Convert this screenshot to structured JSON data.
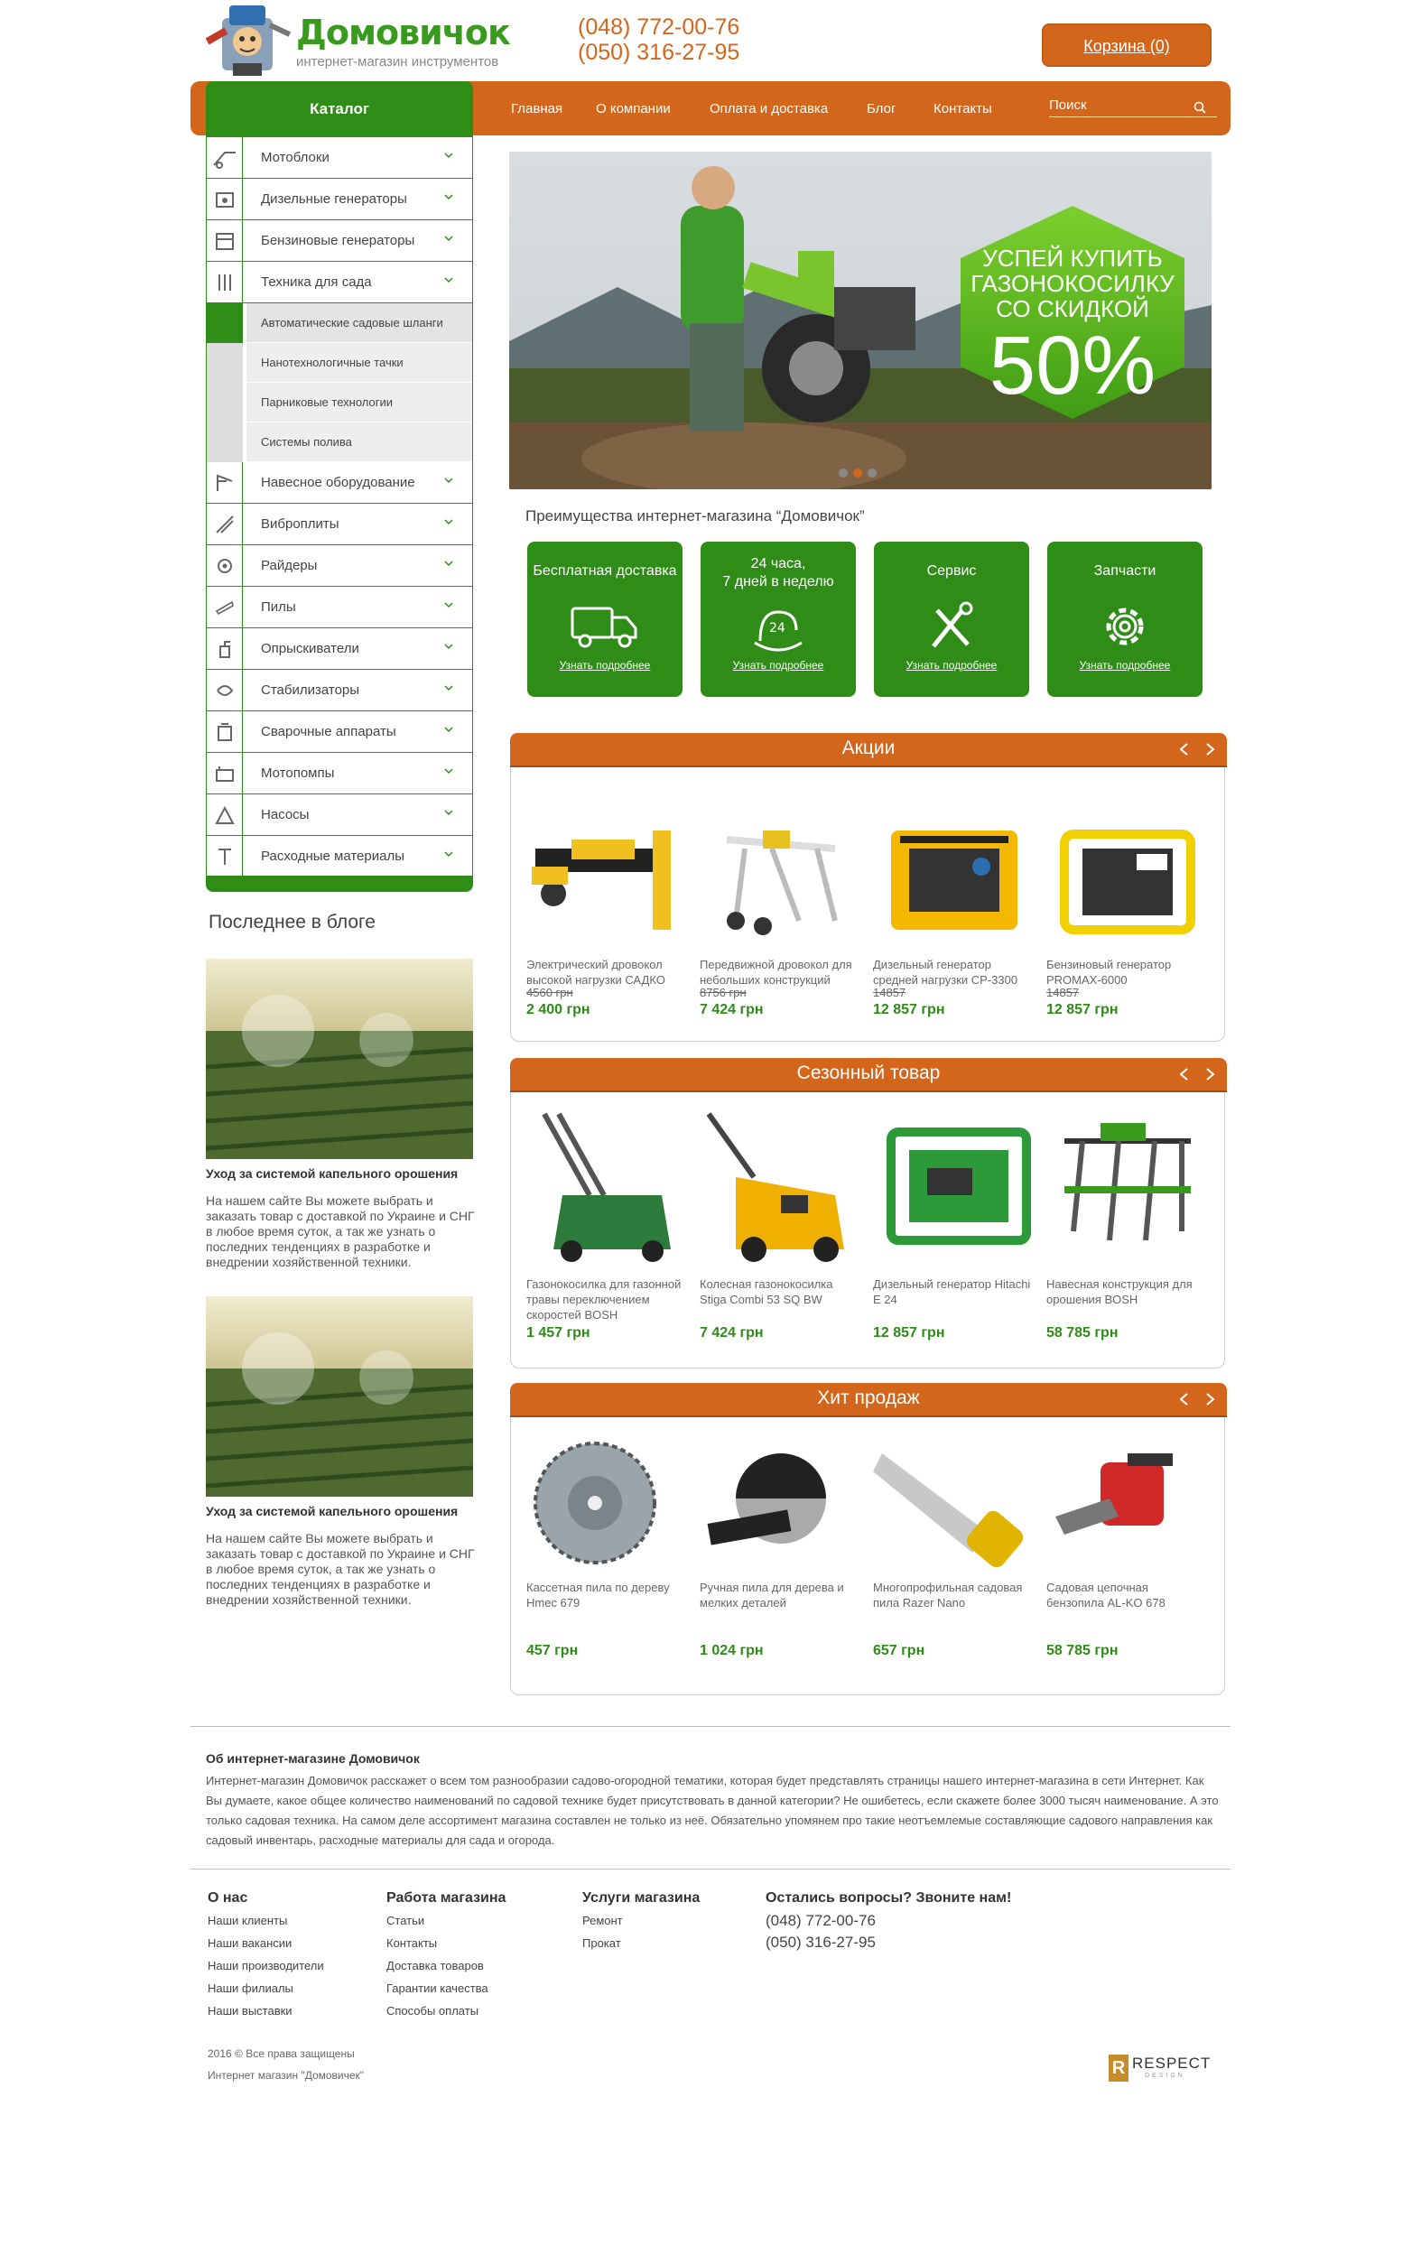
{
  "header": {
    "brand": "Домовичок",
    "tagline": "интернет-магазин инструментов",
    "phone1": "(048) 772-00-76",
    "phone2": "(050) 316-27-95",
    "cart": "Корзина (0)"
  },
  "nav": {
    "items": [
      "Главная",
      "О компании",
      "Оплата и доставка",
      "Блог",
      "Контакты"
    ],
    "search_placeholder": "Поиск"
  },
  "catalog": {
    "title": "Каталог",
    "items_top": [
      "Мотоблоки",
      "Дизельные генераторы",
      "Бензиновые генераторы",
      "Техника для сада"
    ],
    "subitems": [
      "Автоматические садовые шланги",
      "Нанотехнологичные тачки",
      "Парниковые технологии",
      "Системы полива"
    ],
    "items_bottom": [
      "Навесное оборудование",
      "Виброплиты",
      "Райдеры",
      "Пилы",
      "Опрыскиватели",
      "Стабилизаторы",
      "Сварочные аппараты",
      "Мотопомпы",
      "Насосы",
      "Расходные материалы"
    ]
  },
  "banner": {
    "line1": "УСПЕЙ КУПИТЬ",
    "line2": "ГАЗОНОКОСИЛКУ",
    "line3": "СО СКИДКОЙ",
    "percent": "50%"
  },
  "advantages": {
    "title": "Преимущества интернет-магазина “Домовичок”",
    "cards": [
      {
        "line1": "Бесплатная доставка",
        "line2": "",
        "link": "Узнать подробнее",
        "icon": "truck-icon"
      },
      {
        "line1": "24 часа,",
        "line2": "7 дней в неделю",
        "link": "Узнать подробнее",
        "icon": "clock-24-icon"
      },
      {
        "line1": "Сервис",
        "line2": "",
        "link": "Узнать подробнее",
        "icon": "tools-icon"
      },
      {
        "line1": "Запчасти",
        "line2": "",
        "link": "Узнать подробнее",
        "icon": "gear-icon"
      }
    ]
  },
  "sections": [
    {
      "title": "Акции",
      "products": [
        {
          "name": "Электрический дровокол высокой нагрузки САДКО",
          "old": "4560 грн",
          "price": "2 400 грн"
        },
        {
          "name": "Передвижной дровокол для небольших конструкций",
          "old": "8756 грн",
          "price": "7 424 грн"
        },
        {
          "name": "Дизельный генератор средней нагрузки СР-3300",
          "old": "14857",
          "price": "12 857 грн"
        },
        {
          "name": "Бензиновый генератор PROMAX-6000",
          "old": "14857",
          "price": "12 857 грн"
        }
      ]
    },
    {
      "title": "Сезонный товар",
      "products": [
        {
          "name": "Газонокосилка для газонной травы переключением скоростей BOSH",
          "old": "",
          "price": "1 457 грн"
        },
        {
          "name": "Колесная газонокосилка Stiga Combi 53 SQ BW",
          "old": "",
          "price": "7 424 грн"
        },
        {
          "name": "Дизельный генератор Hitachi E 24",
          "old": "",
          "price": "12 857 грн"
        },
        {
          "name": "Навесная конструкция для орошения BOSH",
          "old": "",
          "price": "58 785 грн"
        }
      ]
    },
    {
      "title": "Хит продаж",
      "products": [
        {
          "name": "Кассетная пила по дереву Hmec 679",
          "old": "",
          "price": "457 грн"
        },
        {
          "name": "Ручная пила для дерева и мелких деталей",
          "old": "",
          "price": "1 024 грн"
        },
        {
          "name": "Многопрофильная садовая пила Razer Nano",
          "old": "",
          "price": "657 грн"
        },
        {
          "name": "Садовая цепочная бензопила AL-KO 678",
          "old": "",
          "price": "58 785 грн"
        }
      ]
    }
  ],
  "blog": {
    "title": "Последнее в блоге",
    "posts": [
      {
        "title": "Уход за системой капельного орошения",
        "text": "На нашем сайте Вы можете выбрать и заказать товар с доставкой по Украине и СНГ в любое время суток, а так же узнать о последних тенденциях в разработке и внедрении хозяйственной техники."
      },
      {
        "title": "Уход за системой капельного орошения",
        "text": "На нашем сайте Вы можете выбрать и заказать товар с доставкой по Украине и СНГ в любое время суток, а так же узнать о последних тенденциях в разработке и внедрении хозяйственной техники."
      }
    ]
  },
  "about": {
    "title": "Об интернет-магазине Домовичок",
    "text": "Интернет-магазин Домовичок расскажет о всем том разнообразии садово-огородной тематики, которая будет представлять страницы нашего интернет-магазина в сети Интернет. Как Вы думаете, какое общее количество наименований по садовой технике будет присутствовать в данной категории? Не ошибетесь, если скажете более 3000 тысяч наименование. А это только садовая техника. На самом деле ассортимент магазина составлен не только из неё. Обязательно упомянем про такие неотъемлемые составляющие садового направления как садовый инвентарь, расходные материалы для сада и огорода."
  },
  "footer": {
    "col1": {
      "title": "О нас",
      "links": [
        "Наши клиенты",
        "Наши вакансии",
        "Наши производители",
        "Наши филиалы",
        "Наши выставки"
      ]
    },
    "col2": {
      "title": "Работа магазина",
      "links": [
        "Статьи",
        "Контакты",
        "Доставка товаров",
        "Гарантии качества",
        "Способы оплаты"
      ]
    },
    "col3": {
      "title": "Услуги магазина",
      "links": [
        "Ремонт",
        "Прокат"
      ]
    },
    "col4": {
      "title": "Остались вопросы? Звоните нам!",
      "phone1": "(048) 772-00-76",
      "phone2": "(050) 316-27-95"
    },
    "copyright": "2016 © Все права защищены",
    "shop": "Интернет магазин \"Домовичек\"",
    "designer": "RESPECT",
    "designer_sub": "DESIGN"
  },
  "colors": {
    "orange": "#d4661b",
    "green": "#2e8c17",
    "light_green": "#6cbf2a"
  }
}
